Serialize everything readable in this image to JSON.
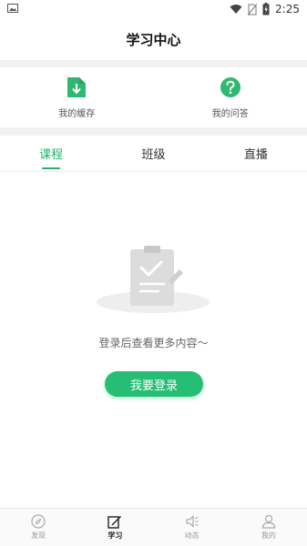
{
  "status_bar": {
    "time": "2:25",
    "left_icon": "image-icon",
    "right_icons": [
      "wifi-icon",
      "no-sim-icon",
      "battery-icon"
    ]
  },
  "header": {
    "title": "学习中心"
  },
  "quick_links": [
    {
      "label": "我的缓存",
      "icon": "download-folder-icon",
      "color": "#2fb970"
    },
    {
      "label": "我的问答",
      "icon": "question-icon",
      "color": "#2fb970"
    }
  ],
  "tabs": [
    {
      "label": "课程",
      "active": true
    },
    {
      "label": "班级",
      "active": false
    },
    {
      "label": "直播",
      "active": false
    }
  ],
  "empty_state": {
    "icon": "empty-clipboard-icon",
    "message": "登录后查看更多内容～",
    "button_label": "我要登录"
  },
  "bottom_nav": [
    {
      "label": "发现",
      "icon": "compass-icon",
      "active": false
    },
    {
      "label": "学习",
      "icon": "edit-note-icon",
      "active": true
    },
    {
      "label": "动态",
      "icon": "speaker-icon",
      "active": false
    },
    {
      "label": "我的",
      "icon": "user-icon",
      "active": false
    }
  ],
  "colors": {
    "accent": "#1fb36b",
    "button": "#25be74"
  }
}
